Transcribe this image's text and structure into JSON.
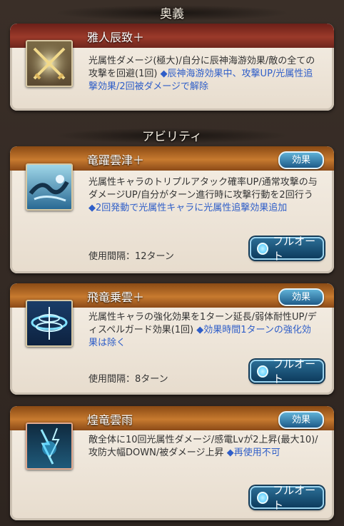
{
  "sections": {
    "ougi": "奥義",
    "abilities": "アビリティ"
  },
  "ougi": {
    "name": "雅人辰致＋",
    "description_plain": "光属性ダメージ(極大)/自分に辰神海游効果/敵の全ての攻撃を回避(1回)",
    "description_note": "◆辰神海游効果中、攻撃UP/光属性追撃効果/2回被ダメージで解除",
    "icon": "crossed-swords-icon"
  },
  "abilities": [
    {
      "name": "竜躍雲津＋",
      "badge": "効果",
      "description_plain": "光属性キャラのトリプルアタック確率UP/通常攻撃の与ダメージUP/自分がターン進行時に攻撃行動を2回行う",
      "description_note": "◆2回発動で光属性キャラに光属性追撃効果追加",
      "cooldown": "使用間隔：12ターン",
      "button": "フルオート",
      "icon": "dragon-ability-icon"
    },
    {
      "name": "飛竜乗雲＋",
      "badge": "効果",
      "description_plain": "光属性キャラの強化効果を1ターン延長/弱体耐性UP/ディスペルガード効果(1回)",
      "description_note": "◆効果時間1ターンの強化効果は除く",
      "cooldown": "使用間隔：8ターン",
      "button": "フルオート",
      "icon": "spiral-wind-icon"
    },
    {
      "name": "煌竜雲雨",
      "badge": "効果",
      "description_plain": "敵全体に10回光属性ダメージ/感電Lvが2上昇(最大10)/攻防大幅DOWN/被ダメージ上昇",
      "description_note": "◆再使用不可",
      "cooldown": "",
      "button": "フルオート",
      "icon": "storm-lightning-icon"
    }
  ]
}
